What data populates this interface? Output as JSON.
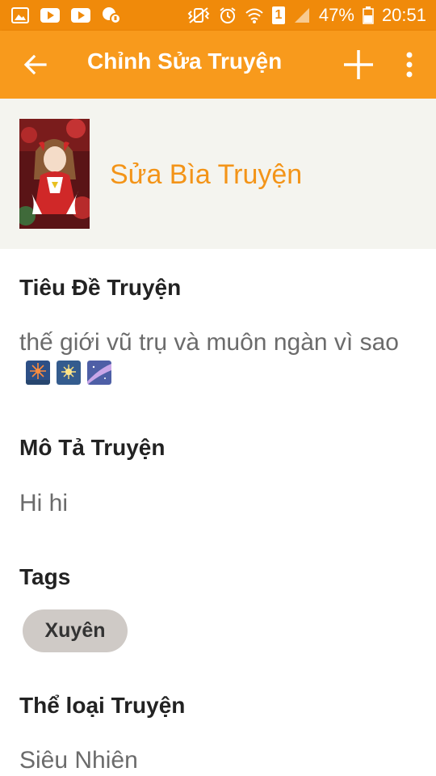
{
  "status_bar": {
    "battery": "47%",
    "time": "20:51",
    "sim_slot": "1"
  },
  "app_bar": {
    "title": "Chỉnh Sửa Truyện"
  },
  "cover": {
    "label": "Sửa Bìa Truyện"
  },
  "fields": {
    "title_heading": "Tiêu Đề Truyện",
    "title_value": "thế giới vũ trụ và muôn ngàn vì sao",
    "description_heading": "Mô Tả Truyện",
    "description_value": "Hi hi",
    "tags_heading": "Tags",
    "category_heading": "Thể loại Truyện",
    "category_value": "Siêu Nhiên"
  },
  "tags": [
    "Xuyên"
  ],
  "colors": {
    "status_bar": "#f08a0a",
    "app_bar": "#f89a1c",
    "accent": "#f39418",
    "cover_bg": "#f4f4ef",
    "tag_bg": "#cfcac6"
  }
}
